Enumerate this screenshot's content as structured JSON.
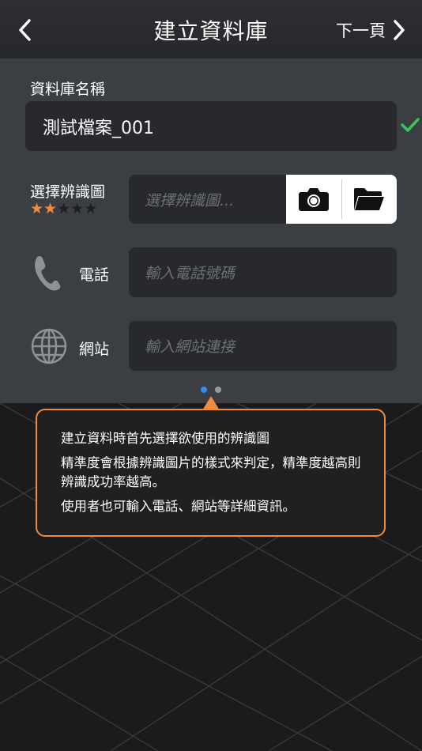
{
  "header": {
    "title": "建立資料庫",
    "next_label": "下一頁",
    "back_icon": "chevron-left-icon",
    "next_icon": "chevron-right-icon"
  },
  "form": {
    "db_name_label": "資料庫名稱",
    "db_name_value": "測試檔案_001",
    "logo_label": "選擇辨識圖",
    "logo_placeholder": "選擇辨識圖...",
    "rating": {
      "filled": 2,
      "total": 5
    },
    "phone_label": "電話",
    "phone_placeholder": "輸入電話號碼",
    "website_label": "網站",
    "website_placeholder": "輸入網站連接"
  },
  "pager": {
    "count": 2,
    "active": 0
  },
  "tooltip": {
    "lines": [
      "建立資料時首先選擇欲使用的辨識圖",
      "精準度會根據辨識圖片的樣式來判定，精準度越高則辨識成功率越高。",
      "使用者也可輸入電話、網站等詳細資訊。"
    ]
  },
  "colors": {
    "accent_orange": "#ef8b3a",
    "check_green": "#35c759",
    "dot_active": "#2f8ff0",
    "dot_inactive": "#9a9a9a",
    "star_filled": "#ef8b3a",
    "star_empty": "#1e1f21"
  }
}
